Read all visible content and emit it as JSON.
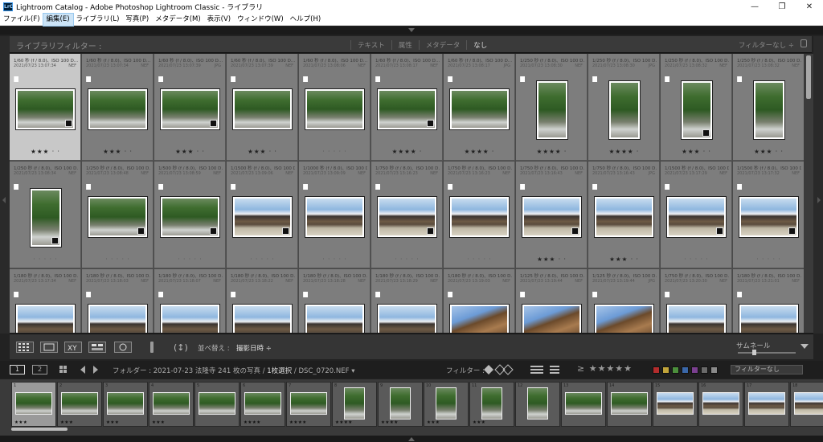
{
  "window": {
    "title": "Lightroom Catalog - Adobe Photoshop Lightroom Classic - ライブラリ",
    "app_icon_text": "LrC",
    "controls": [
      "—",
      "❐",
      "✕"
    ]
  },
  "menu": [
    "ファイル(F)",
    "編集(E)",
    "ライブラリ(L)",
    "写真(P)",
    "メタデータ(M)",
    "表示(V)",
    "ウィンドウ(W)",
    "ヘルプ(H)"
  ],
  "menu_active_index": 1,
  "library_filter": {
    "title": "ライブラリフィルター :",
    "tabs": [
      "テキスト",
      "属性",
      "メタデータ",
      "なし"
    ],
    "selected_tab": "なし",
    "preset": "フィルターなし ÷"
  },
  "grid": {
    "rows": [
      [
        {
          "meta": "1/60 秒 (f / 8.0)、ISO 100 D...",
          "date": "2021/07/23 13:07:34",
          "ext": "NEF",
          "type": "trees",
          "orient": "land",
          "stars": "★★★ · ·",
          "selected": true,
          "badge": true
        },
        {
          "meta": "1/60 秒 (f / 8.0)、ISO 100 D...",
          "date": "2021/07/23 13:07:34",
          "ext": "NEF",
          "type": "trees",
          "orient": "land",
          "stars": "★★★ · ·",
          "badge": false
        },
        {
          "meta": "1/60 秒 (f / 8.0)、ISO 100 D...",
          "date": "2021/07/23 13:07:39",
          "ext": "JPG",
          "type": "trees",
          "orient": "land",
          "stars": "★★★ · ·",
          "badge": true
        },
        {
          "meta": "1/60 秒 (f / 8.0)、ISO 100 D...",
          "date": "2021/07/23 13:07:39",
          "ext": "NEF",
          "type": "trees",
          "orient": "land",
          "stars": "★★★ · ·",
          "badge": false
        },
        {
          "meta": "1/60 秒 (f / 8.0)、ISO 100 D...",
          "date": "2021/07/23 13:08:06",
          "ext": "NEF",
          "type": "trees",
          "orient": "land",
          "stars": "· · · · ·",
          "badge": false
        },
        {
          "meta": "1/60 秒 (f / 8.0)、ISO 100 D...",
          "date": "2021/07/23 13:08:17",
          "ext": "NEF",
          "type": "trees",
          "orient": "land",
          "stars": "★★★★ ·",
          "badge": true
        },
        {
          "meta": "1/60 秒 (f / 8.0)、ISO 100 D...",
          "date": "2021/07/23 13:08:17",
          "ext": "JPG",
          "type": "trees",
          "orient": "land",
          "stars": "★★★★ ·",
          "badge": false
        },
        {
          "meta": "1/250 秒 (f / 8.0)、ISO 100 D...",
          "date": "2021/07/23 13:08:30",
          "ext": "NEF",
          "type": "trees",
          "orient": "port",
          "stars": "★★★★ ·",
          "badge": false
        },
        {
          "meta": "1/250 秒 (f / 8.0)、ISO 100 D...",
          "date": "2021/07/23 13:08:30",
          "ext": "JPG",
          "type": "trees",
          "orient": "port",
          "stars": "★★★★ ·",
          "badge": false
        },
        {
          "meta": "1/250 秒 (f / 8.0)、ISO 100 D...",
          "date": "2021/07/23 13:08:32",
          "ext": "NEF",
          "type": "trees",
          "orient": "port",
          "stars": "★★★ · ·",
          "badge": true
        },
        {
          "meta": "1/250 秒 (f / 8.0)、ISO 100 D...",
          "date": "2021/07/23 13:08:32",
          "ext": "NEF",
          "type": "trees",
          "orient": "port",
          "stars": "★★★ · ·",
          "badge": false
        }
      ],
      [
        {
          "meta": "1/250 秒 (f / 8.0)、ISO 100 D...",
          "date": "2021/07/23 13:08:34",
          "ext": "NEF",
          "type": "trees",
          "orient": "port",
          "stars": "· · · · ·",
          "badge": true
        },
        {
          "meta": "1/250 秒 (f / 8.0)、ISO 100 D...",
          "date": "2021/07/23 13:08:48",
          "ext": "NEF",
          "type": "trees",
          "orient": "land",
          "stars": "· · · · ·",
          "badge": true
        },
        {
          "meta": "1/500 秒 (f / 8.0)、ISO 100 D...",
          "date": "2021/07/23 13:08:59",
          "ext": "NEF",
          "type": "trees",
          "orient": "land",
          "stars": "· · · · ·",
          "badge": true
        },
        {
          "meta": "1/1500 秒 (f / 8.0)、ISO 100 D...",
          "date": "2021/07/23 13:09:06",
          "ext": "NEF",
          "type": "temple",
          "orient": "land",
          "stars": "· · · · ·",
          "badge": true
        },
        {
          "meta": "1/1000 秒 (f / 8.0)、ISO 100 D...",
          "date": "2021/07/23 13:09:09",
          "ext": "NEF",
          "type": "temple",
          "orient": "land",
          "stars": "· · · · ·",
          "badge": false
        },
        {
          "meta": "1/750 秒 (f / 8.0)、ISO 100 D...",
          "date": "2021/07/23 13:16:23",
          "ext": "NEF",
          "type": "temple",
          "orient": "land",
          "stars": "· · · · ·",
          "badge": true
        },
        {
          "meta": "1/750 秒 (f / 8.0)、ISO 100 D...",
          "date": "2021/07/23 13:16:23",
          "ext": "NEF",
          "type": "temple",
          "orient": "land",
          "stars": "· · · · ·",
          "badge": false
        },
        {
          "meta": "1/750 秒 (f / 8.0)、ISO 100 D...",
          "date": "2021/07/23 13:16:43",
          "ext": "NEF",
          "type": "temple",
          "orient": "land",
          "stars": "★★★ · ·",
          "badge": true
        },
        {
          "meta": "1/750 秒 (f / 8.0)、ISO 100 D...",
          "date": "2021/07/23 13:16:43",
          "ext": "JPG",
          "type": "temple",
          "orient": "land",
          "stars": "★★★ · ·",
          "badge": false
        },
        {
          "meta": "1/1500 秒 (f / 8.0)、ISO 100 D...",
          "date": "2021/07/23 13:17:29",
          "ext": "NEF",
          "type": "temple",
          "orient": "land",
          "stars": "· · · · ·",
          "badge": true
        },
        {
          "meta": "1/1500 秒 (f / 8.0)、ISO 100 D...",
          "date": "2021/07/23 13:17:32",
          "ext": "NEF",
          "type": "temple",
          "orient": "land",
          "stars": "· · · · ·",
          "badge": true
        }
      ],
      [
        {
          "meta": "1/180 秒 (f / 8.0)、ISO 100 D...",
          "date": "2021/07/23 13:17:34",
          "ext": "NEF",
          "type": "temple",
          "orient": "land",
          "stars": "",
          "badge": false
        },
        {
          "meta": "1/180 秒 (f / 8.0)、ISO 100 D...",
          "date": "2021/07/23 13:18:03",
          "ext": "NEF",
          "type": "temple",
          "orient": "land",
          "stars": "",
          "badge": false
        },
        {
          "meta": "1/180 秒 (f / 8.0)、ISO 100 D...",
          "date": "2021/07/23 13:18:07",
          "ext": "NEF",
          "type": "temple",
          "orient": "land",
          "stars": "",
          "badge": false
        },
        {
          "meta": "1/180 秒 (f / 8.0)、ISO 100 D...",
          "date": "2021/07/23 13:18:22",
          "ext": "NEF",
          "type": "temple",
          "orient": "land",
          "stars": "",
          "badge": false
        },
        {
          "meta": "1/180 秒 (f / 8.0)、ISO 100 D...",
          "date": "2021/07/23 13:18:28",
          "ext": "NEF",
          "type": "temple",
          "orient": "land",
          "stars": "",
          "badge": false
        },
        {
          "meta": "1/180 秒 (f / 8.0)、ISO 100 D...",
          "date": "2021/07/23 13:18:29",
          "ext": "NEF",
          "type": "temple",
          "orient": "land",
          "stars": "",
          "badge": false
        },
        {
          "meta": "1/180 秒 (f / 8.0)、ISO 100 D...",
          "date": "2021/07/23 13:19:03",
          "ext": "NEF",
          "type": "roof",
          "orient": "land",
          "stars": "",
          "badge": false
        },
        {
          "meta": "1/125 秒 (f / 8.0)、ISO 100 D...",
          "date": "2021/07/23 13:19:44",
          "ext": "NEF",
          "type": "roof",
          "orient": "land",
          "stars": "",
          "badge": false
        },
        {
          "meta": "1/125 秒 (f / 8.0)、ISO 100 D...",
          "date": "2021/07/23 13:19:44",
          "ext": "JPG",
          "type": "roof",
          "orient": "land",
          "stars": "",
          "badge": false
        },
        {
          "meta": "1/750 秒 (f / 8.0)、ISO 100 D...",
          "date": "2021/07/23 13:20:30",
          "ext": "NEF",
          "type": "temple",
          "orient": "land",
          "stars": "",
          "badge": false
        },
        {
          "meta": "1/180 秒 (f / 8.0)、ISO 100 D...",
          "date": "2021/07/23 13:21:01",
          "ext": "NEF",
          "type": "temple",
          "orient": "land",
          "stars": "",
          "badge": false
        }
      ]
    ]
  },
  "toolbar": {
    "sort_label": "並べ替え :",
    "sort_value": "撮影日時 ÷",
    "thumb_label": "サムネール"
  },
  "filmstrip_bar": {
    "page1": "1",
    "page2": "2",
    "info_prefix": "フォルダー : 2021-07-23 法隆寺  241 枚の写真 / ",
    "info_selected": "1枚選択",
    "info_suffix": " / DSC_0720.NEF ▾",
    "filter_label": "フィルター :",
    "rating_stars": "≥ ★★★★★",
    "label_colors": [
      "#b32c2c",
      "#c1a43a",
      "#4c8f3c",
      "#3a67a8",
      "#7a3f8f",
      "#6a6a6a",
      "#8a8a8a"
    ],
    "filter_preset": "フィルターなし"
  },
  "filmstrip": [
    {
      "num": "1",
      "stars": "★★★",
      "type": "trees",
      "orient": "land",
      "selected": true
    },
    {
      "num": "2",
      "stars": "★★★",
      "type": "trees",
      "orient": "land"
    },
    {
      "num": "3",
      "stars": "★★★",
      "type": "trees",
      "orient": "land"
    },
    {
      "num": "4",
      "stars": "★★★",
      "type": "trees",
      "orient": "land"
    },
    {
      "num": "5",
      "stars": "",
      "type": "trees",
      "orient": "land"
    },
    {
      "num": "6",
      "stars": "★★★★",
      "type": "trees",
      "orient": "land"
    },
    {
      "num": "7",
      "stars": "★★★★",
      "type": "trees",
      "orient": "land"
    },
    {
      "num": "8",
      "stars": "★★★★",
      "type": "trees",
      "orient": "port"
    },
    {
      "num": "9",
      "stars": "★★★★",
      "type": "trees",
      "orient": "port"
    },
    {
      "num": "10",
      "stars": "★★★",
      "type": "trees",
      "orient": "port"
    },
    {
      "num": "11",
      "stars": "★★★",
      "type": "trees",
      "orient": "port"
    },
    {
      "num": "12",
      "stars": "",
      "type": "trees",
      "orient": "port"
    },
    {
      "num": "13",
      "stars": "",
      "type": "trees",
      "orient": "land"
    },
    {
      "num": "14",
      "stars": "",
      "type": "trees",
      "orient": "land"
    },
    {
      "num": "15",
      "stars": "",
      "type": "temple",
      "orient": "land"
    },
    {
      "num": "16",
      "stars": "",
      "type": "temple",
      "orient": "land"
    },
    {
      "num": "17",
      "stars": "",
      "type": "temple",
      "orient": "land"
    },
    {
      "num": "18",
      "stars": "",
      "type": "temple",
      "orient": "land"
    }
  ]
}
